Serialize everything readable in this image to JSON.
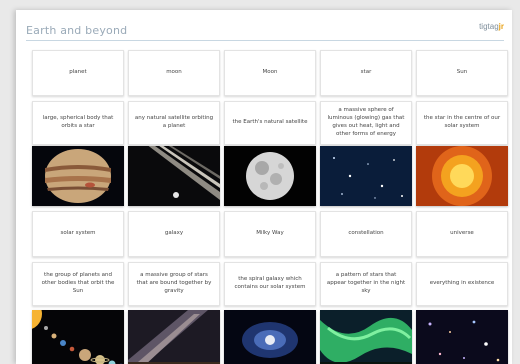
{
  "title": "Earth and beyond",
  "brand": {
    "name": "tigtag",
    "mark": "jr"
  },
  "rows": [
    {
      "words": [
        "planet",
        "moon",
        "Moon",
        "star",
        "Sun"
      ],
      "definitions": [
        "large, spherical body that orbits a star",
        "any natural satellite orbiting a planet",
        "the Earth's natural satellite",
        "a massive sphere of luminous (glowing) gas that gives out heat, light and other forms of energy",
        "the star in the centre of our solar system"
      ],
      "images": [
        "jupiter-image",
        "saturn-rings-image",
        "full-moon-image",
        "starfield-image",
        "sun-image"
      ]
    },
    {
      "words": [
        "solar system",
        "galaxy",
        "Milky Way",
        "constellation",
        "universe"
      ],
      "definitions": [
        "the group of planets and other bodies that orbit the Sun",
        "a massive group of stars that are bound together by gravity",
        "the spiral galaxy which contains our solar system",
        "a pattern of stars that appear together in the night sky",
        "everything in existence"
      ],
      "images": [
        "solar-system-image",
        "milky-band-image",
        "spiral-galaxy-image",
        "aurora-image",
        "deep-field-image"
      ]
    }
  ]
}
